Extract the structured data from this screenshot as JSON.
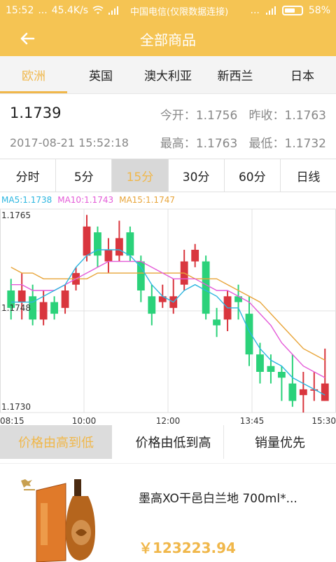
{
  "status_bar": {
    "time": "15:52",
    "dots": "...",
    "net_speed": "45.4K/s",
    "carrier": "中国电信(仅限数据连接)",
    "battery": "58%"
  },
  "app_bar": {
    "title": "全部商品"
  },
  "region_tabs": [
    {
      "label": "欧洲",
      "active": true
    },
    {
      "label": "英国",
      "active": false
    },
    {
      "label": "澳大利亚",
      "active": false
    },
    {
      "label": "新西兰",
      "active": false
    },
    {
      "label": "日本",
      "active": false
    }
  ],
  "quote": {
    "price": "1.1739",
    "datetime": "2017-08-21 15:52:18",
    "open_label": "今开：",
    "open": "1.1756",
    "prev_close_label": "昨收：",
    "prev_close": "1.1763",
    "high_label": "最高：",
    "high": "1.1763",
    "low_label": "最低：",
    "low": "1.1732"
  },
  "periods": [
    {
      "label": "分时",
      "active": false
    },
    {
      "label": "5分",
      "active": false
    },
    {
      "label": "15分",
      "active": true
    },
    {
      "label": "30分",
      "active": false
    },
    {
      "label": "60分",
      "active": false
    },
    {
      "label": "日线",
      "active": false
    }
  ],
  "ma_legend": {
    "ma5": "MA5:1.1738",
    "ma10": "MA10:1.1743",
    "ma15": "MA15:1.1747"
  },
  "colors": {
    "accent": "#f0b74a",
    "bar": "#f5c453",
    "up": "#d9363e",
    "down": "#2bd27a",
    "ma5": "#2cb6e0",
    "ma10": "#e45bd8",
    "ma15": "#e8a53a"
  },
  "chart_data": {
    "type": "candlestick",
    "y_labels": [
      "1.1765",
      "1.1748",
      "1.1730"
    ],
    "ylim": [
      1.173,
      1.1765
    ],
    "x_labels": [
      "08:15",
      "10:00",
      "12:00",
      "13:45",
      "15:30"
    ],
    "candles": [
      {
        "o": 1.1751,
        "c": 1.1748,
        "h": 1.1753,
        "l": 1.1746
      },
      {
        "o": 1.1749,
        "c": 1.1751,
        "h": 1.1754,
        "l": 1.1746
      },
      {
        "o": 1.175,
        "c": 1.1746,
        "h": 1.1752,
        "l": 1.1745
      },
      {
        "o": 1.1746,
        "c": 1.1749,
        "h": 1.1751,
        "l": 1.1745
      },
      {
        "o": 1.1749,
        "c": 1.1747,
        "h": 1.175,
        "l": 1.1746
      },
      {
        "o": 1.1748,
        "c": 1.1751,
        "h": 1.1752,
        "l": 1.1747
      },
      {
        "o": 1.1752,
        "c": 1.1754,
        "h": 1.1755,
        "l": 1.1751
      },
      {
        "o": 1.1757,
        "c": 1.1762,
        "h": 1.1764,
        "l": 1.1756
      },
      {
        "o": 1.1761,
        "c": 1.1757,
        "h": 1.1762,
        "l": 1.1755
      },
      {
        "o": 1.1756,
        "c": 1.1758,
        "h": 1.176,
        "l": 1.1754
      },
      {
        "o": 1.1757,
        "c": 1.176,
        "h": 1.1763,
        "l": 1.1756
      },
      {
        "o": 1.1761,
        "c": 1.1757,
        "h": 1.1762,
        "l": 1.1756
      },
      {
        "o": 1.1756,
        "c": 1.1751,
        "h": 1.1757,
        "l": 1.1749
      },
      {
        "o": 1.175,
        "c": 1.1747,
        "h": 1.1752,
        "l": 1.1745
      },
      {
        "o": 1.1749,
        "c": 1.175,
        "h": 1.1752,
        "l": 1.1748
      },
      {
        "o": 1.1748,
        "c": 1.175,
        "h": 1.1753,
        "l": 1.1747
      },
      {
        "o": 1.1752,
        "c": 1.1756,
        "h": 1.1758,
        "l": 1.1751
      },
      {
        "o": 1.1756,
        "c": 1.1758,
        "h": 1.1759,
        "l": 1.1755
      },
      {
        "o": 1.1756,
        "c": 1.1747,
        "h": 1.1757,
        "l": 1.1746
      },
      {
        "o": 1.1746,
        "c": 1.1745,
        "h": 1.1748,
        "l": 1.1743
      },
      {
        "o": 1.1746,
        "c": 1.175,
        "h": 1.1751,
        "l": 1.1744
      },
      {
        "o": 1.175,
        "c": 1.1749,
        "h": 1.1752,
        "l": 1.1746
      },
      {
        "o": 1.1747,
        "c": 1.174,
        "h": 1.175,
        "l": 1.1738
      },
      {
        "o": 1.174,
        "c": 1.1737,
        "h": 1.1742,
        "l": 1.1735
      },
      {
        "o": 1.1738,
        "c": 1.1737,
        "h": 1.174,
        "l": 1.1735
      },
      {
        "o": 1.1737,
        "c": 1.1736,
        "h": 1.1738,
        "l": 1.1732
      },
      {
        "o": 1.1735,
        "c": 1.1732,
        "h": 1.174,
        "l": 1.1731
      },
      {
        "o": 1.1733,
        "c": 1.1734,
        "h": 1.1737,
        "l": 1.173
      },
      {
        "o": 1.1734,
        "c": 1.1734,
        "h": 1.1737,
        "l": 1.1732
      },
      {
        "o": 1.1732,
        "c": 1.1735,
        "h": 1.1741,
        "l": 1.1732
      }
    ],
    "ma5": [
      1.1749,
      1.1749,
      1.1749,
      1.175,
      1.1751,
      1.1752,
      1.1755,
      1.1757,
      1.1758,
      1.1758,
      1.1758,
      1.1757,
      1.1755,
      1.1752,
      1.175,
      1.1749,
      1.1751,
      1.1752,
      1.1751,
      1.175,
      1.1748,
      1.1748,
      1.1744,
      1.1741,
      1.1739,
      1.1738,
      1.1736,
      1.1735,
      1.1734,
      1.1733
    ],
    "ma10": [
      1.1752,
      1.1752,
      1.1751,
      1.1751,
      1.1751,
      1.1752,
      1.1753,
      1.1754,
      1.1755,
      1.1756,
      1.1756,
      1.1756,
      1.1756,
      1.1755,
      1.1754,
      1.1753,
      1.1753,
      1.1753,
      1.1752,
      1.1751,
      1.1751,
      1.175,
      1.1749,
      1.1747,
      1.1745,
      1.1742,
      1.174,
      1.1738,
      1.1737,
      1.1736
    ],
    "ma15": [
      1.1755,
      1.1754,
      1.1754,
      1.1753,
      1.1753,
      1.1753,
      1.1753,
      1.1753,
      1.1754,
      1.1754,
      1.1754,
      1.1754,
      1.1754,
      1.1754,
      1.1754,
      1.1754,
      1.1754,
      1.1753,
      1.1753,
      1.1753,
      1.1752,
      1.1751,
      1.175,
      1.1749,
      1.1747,
      1.1745,
      1.1743,
      1.1741,
      1.174,
      1.1739
    ]
  },
  "sort_options": [
    {
      "label": "价格由高到低",
      "active": true
    },
    {
      "label": "价格由低到高",
      "active": false
    },
    {
      "label": "销量优先",
      "active": false
    }
  ],
  "product": {
    "name": "墨高XO干邑白兰地  700ml*...",
    "price": "￥123223.94",
    "thumb_icon": "cognac-bottle-image"
  }
}
